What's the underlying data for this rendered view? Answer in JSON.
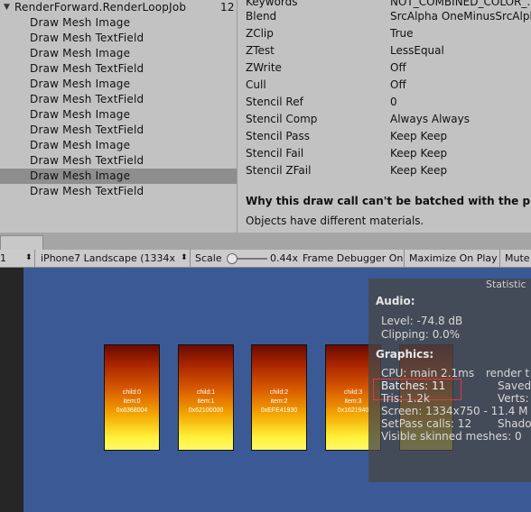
{
  "tree": {
    "root": {
      "label": "RenderForward.RenderLoopJob",
      "count": "12"
    },
    "items": [
      {
        "label": "Draw Mesh Image",
        "selected": false
      },
      {
        "label": "Draw Mesh TextField",
        "selected": false
      },
      {
        "label": "Draw Mesh Image",
        "selected": false
      },
      {
        "label": "Draw Mesh TextField",
        "selected": false
      },
      {
        "label": "Draw Mesh Image",
        "selected": false
      },
      {
        "label": "Draw Mesh TextField",
        "selected": false
      },
      {
        "label": "Draw Mesh Image",
        "selected": false
      },
      {
        "label": "Draw Mesh TextField",
        "selected": false
      },
      {
        "label": "Draw Mesh Image",
        "selected": false
      },
      {
        "label": "Draw Mesh TextField",
        "selected": false
      },
      {
        "label": "Draw Mesh Image",
        "selected": true
      },
      {
        "label": "Draw Mesh TextField",
        "selected": false
      }
    ]
  },
  "props": {
    "rows": [
      {
        "key": "Keywords",
        "value": "NOT_COMBINED_COLOR_..."
      },
      {
        "key": "Blend",
        "value": "SrcAlpha OneMinusSrcAlph"
      },
      {
        "key": "ZClip",
        "value": "True"
      },
      {
        "key": "ZTest",
        "value": "LessEqual"
      },
      {
        "key": "ZWrite",
        "value": "Off"
      },
      {
        "key": "Cull",
        "value": "Off"
      },
      {
        "key": "Stencil Ref",
        "value": "0"
      },
      {
        "key": "Stencil Comp",
        "value": "Always Always"
      },
      {
        "key": "Stencil Pass",
        "value": "Keep Keep"
      },
      {
        "key": "Stencil Fail",
        "value": "Keep Keep"
      },
      {
        "key": "Stencil ZFail",
        "value": "Keep Keep"
      }
    ],
    "why_title": "Why this draw call can't be batched with the p",
    "why_detail": "Objects have different materials."
  },
  "toolbar": {
    "display": "1",
    "resolution": "iPhone7 Landscape (1334x",
    "scale_label": "Scale",
    "scale_value": "0.44x",
    "frame_debugger": "Frame Debugger On",
    "maximize": "Maximize On Play",
    "mute": "Mute"
  },
  "cards": [
    {
      "name": "child:0",
      "item": "item:0",
      "hash": "0x8368004"
    },
    {
      "name": "child:1",
      "item": "item:1",
      "hash": "0x62100000"
    },
    {
      "name": "child:2",
      "item": "item:2",
      "hash": "0xEFE41930"
    },
    {
      "name": "child:3",
      "item": "item:3",
      "hash": "0x1621940"
    }
  ],
  "stats": {
    "title": "Statistic",
    "audio_header": "Audio:",
    "level": "Level: -74.8 dB",
    "clipping": "Clipping: 0.0%",
    "graphics_header": "Graphics:",
    "cpu": "CPU: main 2.1ms",
    "render": "render t",
    "batches": "Batches: 11",
    "saved": "Saved",
    "tris": "Tris: 1.2k",
    "verts": "Verts:",
    "screen": "Screen: 1334x750 - 11.4 M",
    "setpass": "SetPass calls: 12",
    "shadow": "Shado",
    "skinned": "Visible skinned meshes: 0"
  }
}
